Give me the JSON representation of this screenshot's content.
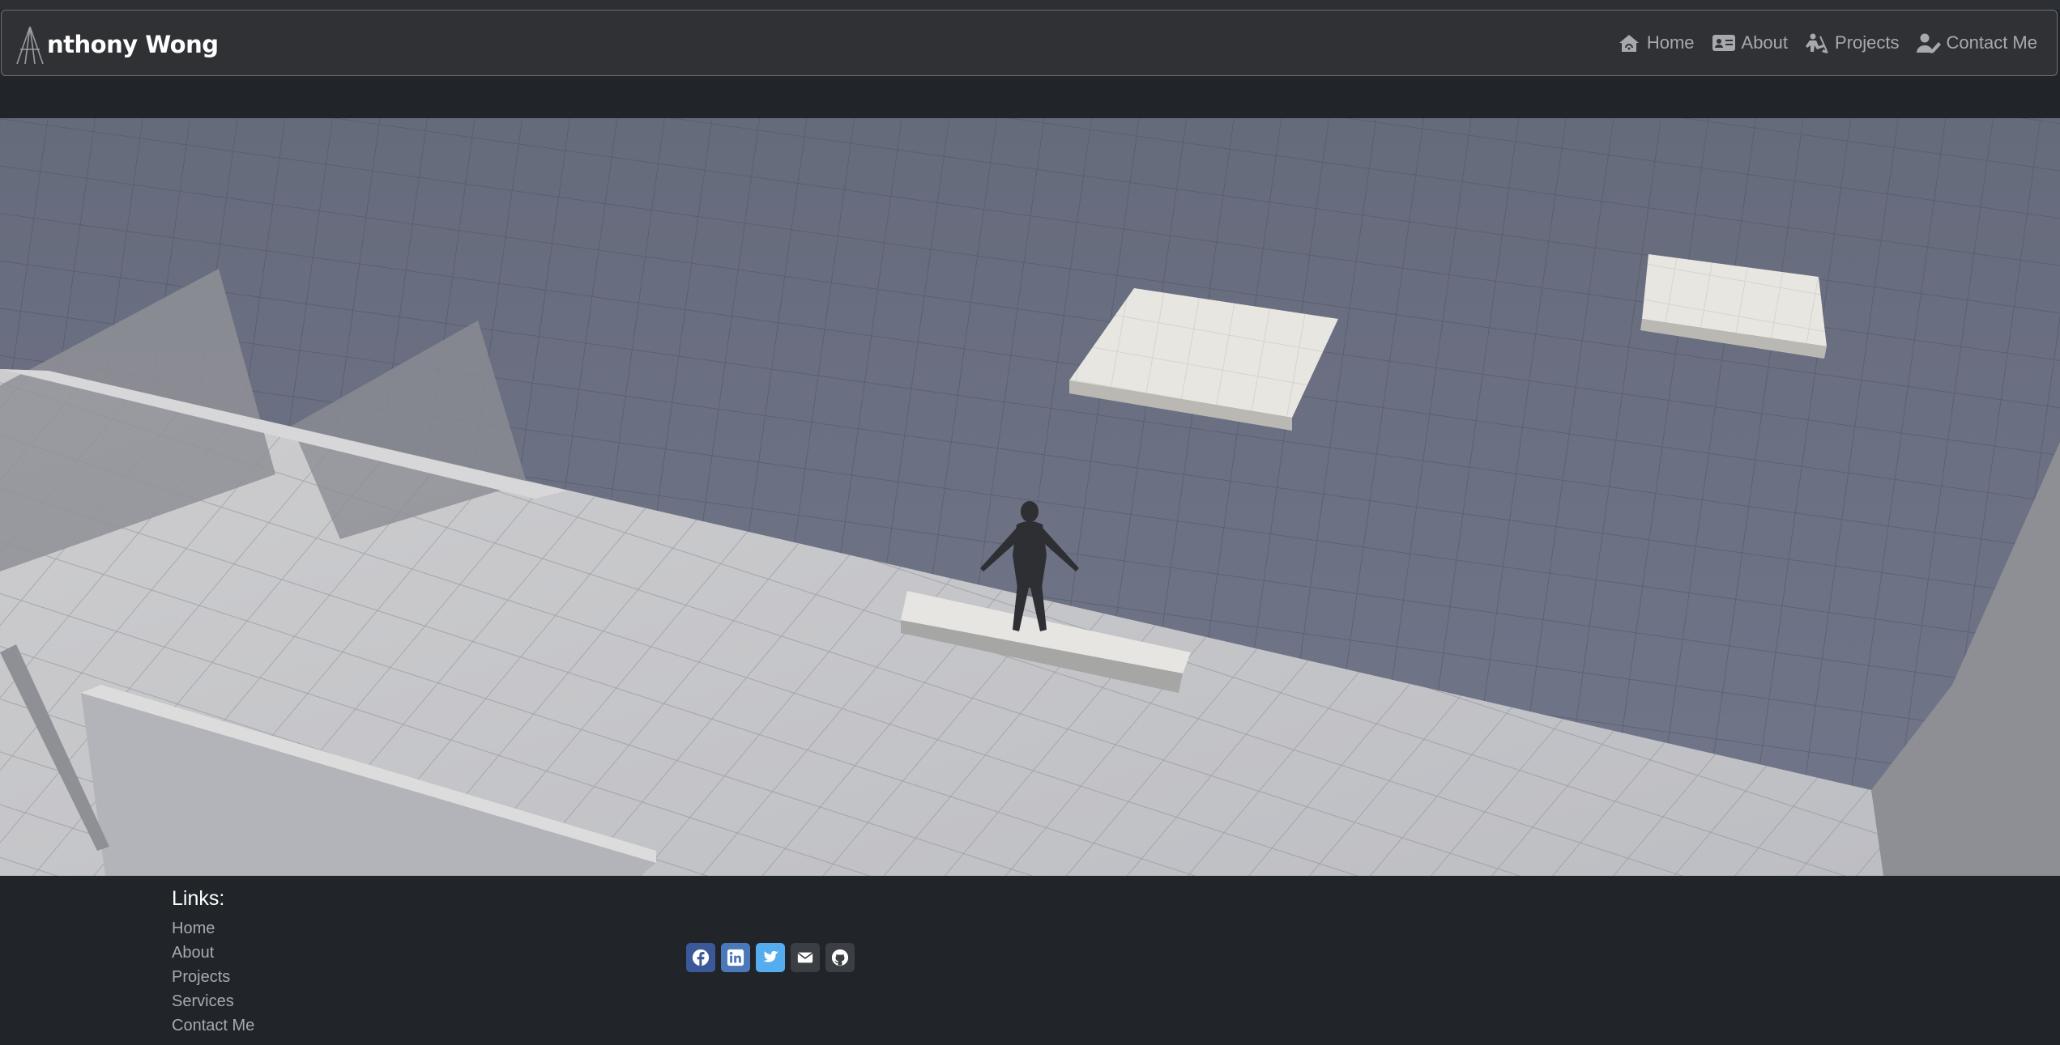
{
  "brand": {
    "name": "nthony Wong"
  },
  "nav": {
    "items": [
      {
        "label": "Home",
        "icon": "home-wifi-icon"
      },
      {
        "label": "About",
        "icon": "id-card-icon"
      },
      {
        "label": "Projects",
        "icon": "person-digging-icon"
      },
      {
        "label": "Contact Me",
        "icon": "user-pen-icon"
      }
    ]
  },
  "footer": {
    "heading": "Links:",
    "links": [
      "Home",
      "About",
      "Projects",
      "Services",
      "Contact Me"
    ],
    "social": [
      {
        "icon": "facebook-icon",
        "color": "#3b5998"
      },
      {
        "icon": "linkedin-icon",
        "color": "#4a78b8"
      },
      {
        "icon": "twitter-icon",
        "color": "#55acee"
      },
      {
        "icon": "email-icon",
        "color": "#3b3e42"
      },
      {
        "icon": "github-icon",
        "color": "#3b3e42"
      }
    ]
  },
  "colors": {
    "background": "#212529",
    "navbar": "#303134",
    "nav_text": "#a7a9ad",
    "scene_wall": "#6a6f80",
    "scene_floor": "#c4c5c9"
  }
}
